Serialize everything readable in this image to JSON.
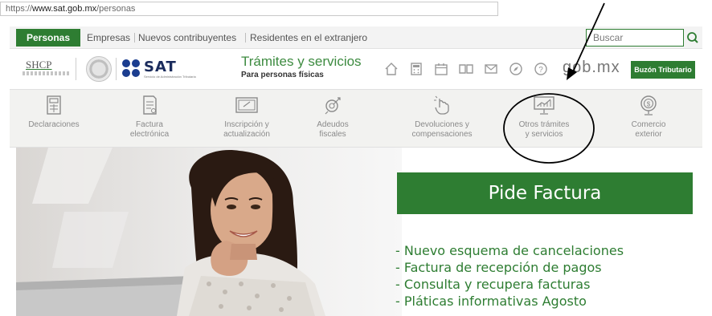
{
  "browser": {
    "url_scheme": "https://",
    "url_domain": "www.sat.gob.mx",
    "url_path": "/personas"
  },
  "topnav": {
    "active_tab": "Personas",
    "tabs": [
      "Empresas",
      "Nuevos contribuyentes",
      "Residentes en el extranjero"
    ],
    "search_placeholder": "Buscar"
  },
  "brand": {
    "shcp": "SHCP",
    "sat": "SAT",
    "sat_tagline": "Servicio de Administración Tributaria",
    "title": "Trámites y servicios",
    "subtitle": "Para personas físicas",
    "icons": [
      "home-icon",
      "calculator-icon",
      "calendar-icon",
      "book-icon",
      "mail-icon",
      "compass-icon",
      "help-icon"
    ],
    "gobmx": "gob.mx",
    "buzon": "Buzón Tributario"
  },
  "menu": {
    "items": [
      {
        "label1": "Declaraciones",
        "label2": "",
        "icon": "calculator-icon"
      },
      {
        "label1": "Factura",
        "label2": "electrónica",
        "icon": "invoice-icon"
      },
      {
        "label1": "Inscripción y",
        "label2": "actualización",
        "icon": "id-card-icon"
      },
      {
        "label1": "Adeudos",
        "label2": "fiscales",
        "icon": "target-arrows-icon"
      },
      {
        "label1": "Devoluciones y",
        "label2": "compensaciones",
        "icon": "hand-touch-icon"
      },
      {
        "label1": "Otros trámites",
        "label2": "y servicios",
        "icon": "presentation-icon"
      },
      {
        "label1": "Comercio",
        "label2": "exterior",
        "icon": "globe-dollar-icon"
      }
    ]
  },
  "hero": {
    "banner": "Pide Factura",
    "bullets": [
      "- Nuevo esquema de cancelaciones",
      "- Factura de recepción de pagos",
      "- Consulta y recupera facturas",
      "- Pláticas informativas Agosto"
    ]
  },
  "colors": {
    "brand_green": "#2e7d32",
    "sat_blue": "#1b3d8f",
    "annotation": "#000000"
  }
}
